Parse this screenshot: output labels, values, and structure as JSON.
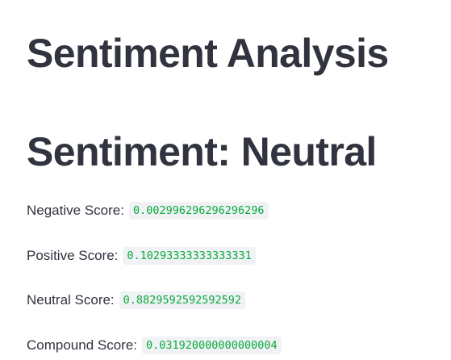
{
  "page": {
    "title": "Sentiment Analysis",
    "sentiment_heading": "Sentiment: Neutral"
  },
  "scores": [
    {
      "label": "Negative Score:",
      "value": "0.002996296296296296"
    },
    {
      "label": "Positive Score:",
      "value": "0.10293333333333331"
    },
    {
      "label": "Neutral Score:",
      "value": "0.8829592592592592"
    },
    {
      "label": "Compound Score:",
      "value": "0.031920000000000004"
    }
  ],
  "colors": {
    "text": "#31333f",
    "code_text": "#09ab3b",
    "code_background": "#f0f2f6",
    "background": "#ffffff"
  }
}
